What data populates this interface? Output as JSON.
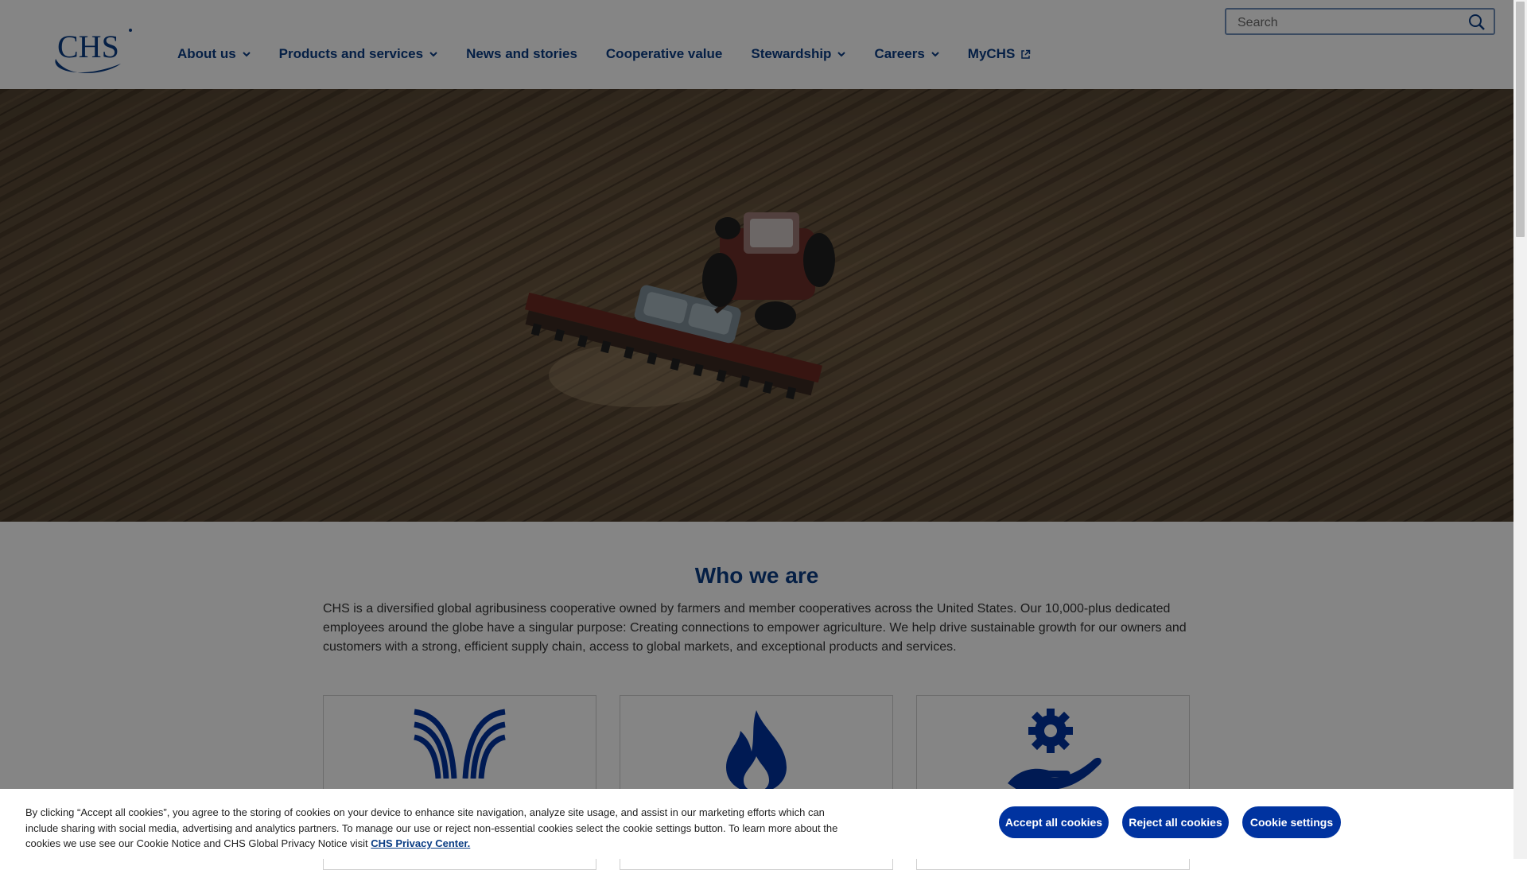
{
  "header": {
    "logo_text": "CHS",
    "nav": [
      {
        "label": "About us"
      },
      {
        "label": "Products and services"
      },
      {
        "label": "News and stories"
      },
      {
        "label": "Cooperative value"
      },
      {
        "label": "Stewardship"
      },
      {
        "label": "Careers"
      },
      {
        "label": "MyCHS"
      }
    ],
    "search": {
      "placeholder": "Search",
      "icon": "search-icon"
    }
  },
  "hero": {
    "image": "tractor-planting-field"
  },
  "who": {
    "title": "Who we are",
    "text": "CHS is a diversified global agribusiness cooperative owned by farmers and member cooperatives across the United States. Our 10,000-plus dedicated employees around the globe have a singular purpose: Creating connections to empower agriculture. We help drive sustainable growth for our owners and customers with a strong, efficient supply chain, access to global markets, and exceptional products and services.",
    "cards": [
      {
        "icon": "agronomy-field-icon"
      },
      {
        "icon": "energy-flame-icon"
      },
      {
        "icon": "hand-gear-icon"
      }
    ]
  },
  "cookie": {
    "text": "By clicking “Accept all cookies”, you agree to the storing of cookies on your device to enhance site navigation, analyze site usage, and assist in our marketing efforts which can include sharing with social media, advertising and analytics partners. To manage our use or reject non-essential cookies select the cookie settings button. To learn more about the cookies we use see our Cookie Notice and CHS Global Privacy Notice visit",
    "link": "CHS Privacy Center.",
    "accept": "Accept all cookies",
    "reject": "Reject all cookies",
    "settings": "Cookie settings"
  },
  "colors": {
    "brand_blue": "#0a3d84",
    "button_blue": "#0033a0"
  }
}
